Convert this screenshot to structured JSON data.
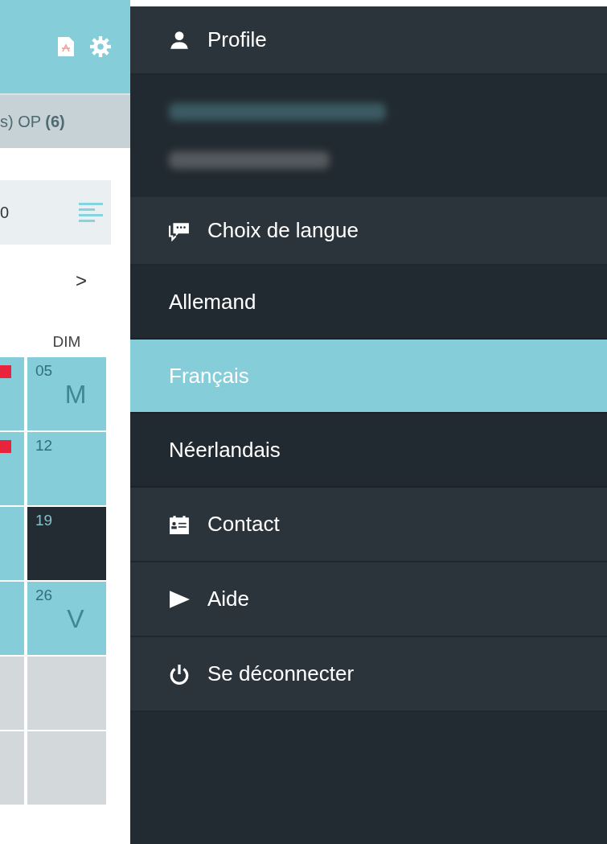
{
  "background_page": {
    "tab_bar": {
      "text": "s) OP **(6)**"
    },
    "summary": {
      "value": "0"
    },
    "next_button": ">",
    "day_header": "DIM",
    "calendar_rows": [
      {
        "kind": "available",
        "badge": true,
        "day": "05",
        "letter": "M"
      },
      {
        "kind": "available",
        "badge": true,
        "day": "12"
      },
      {
        "kind": "today",
        "badge": false,
        "day": "19"
      },
      {
        "kind": "available",
        "badge": false,
        "day": "26",
        "letter": "V"
      },
      {
        "kind": "empty",
        "badge": false
      },
      {
        "kind": "empty",
        "badge": false
      }
    ]
  },
  "menu": {
    "items": [
      {
        "kind": "header",
        "label": "Profile"
      },
      {
        "kind": "redacted"
      },
      {
        "kind": "header",
        "label": "Choix de langue"
      },
      {
        "kind": "option",
        "label": "Allemand",
        "selected": false
      },
      {
        "kind": "option",
        "label": "Français",
        "selected": true
      },
      {
        "kind": "option",
        "label": "Néerlandais",
        "selected": false
      },
      {
        "kind": "link",
        "label": "Contact"
      },
      {
        "kind": "link",
        "label": "Aide"
      },
      {
        "kind": "link",
        "label": "Se déconnecter"
      }
    ]
  }
}
